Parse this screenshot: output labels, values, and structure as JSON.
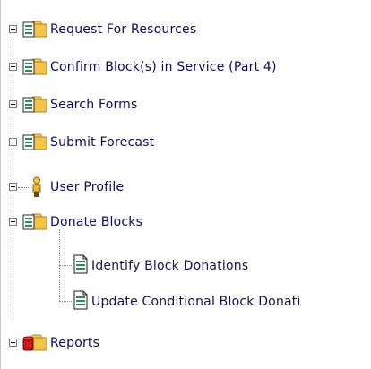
{
  "tree": {
    "nodes": [
      {
        "label": "Request For Resources",
        "icon": "folder-form-icon",
        "state": "collapsed"
      },
      {
        "label": "Confirm Block(s) in Service (Part 4)",
        "icon": "folder-form-icon",
        "state": "collapsed"
      },
      {
        "label": "Search Forms",
        "icon": "folder-form-icon",
        "state": "collapsed"
      },
      {
        "label": "Submit Forecast",
        "icon": "folder-form-icon",
        "state": "collapsed"
      },
      {
        "label": "User Profile",
        "icon": "user-icon",
        "state": "collapsed"
      },
      {
        "label": "Donate Blocks",
        "icon": "folder-form-icon",
        "state": "expanded",
        "children": [
          {
            "label": "Identify Block Donations",
            "icon": "document-icon"
          },
          {
            "label": "Update Conditional Block Donati",
            "icon": "document-icon"
          }
        ]
      },
      {
        "label": "Reports",
        "icon": "folder-reports-icon",
        "state": "collapsed"
      }
    ]
  },
  "colors": {
    "text": "#0b0b5a",
    "folder": "#f2c44a",
    "folder_dark": "#c8901a",
    "form_green": "#2d8a5a",
    "report_red": "#d01818"
  }
}
